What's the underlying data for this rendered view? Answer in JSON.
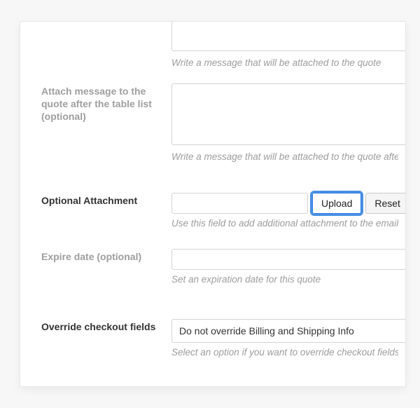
{
  "fields": {
    "msg_before": {
      "value": "",
      "helper": "Write a message that will be attached to the quote"
    },
    "msg_after": {
      "label": "Attach message to the quote after the table list (optional)",
      "value": "",
      "helper": "Write a message that will be attached to the quote after the table list"
    },
    "attachment": {
      "label": "Optional Attachment",
      "value": "",
      "upload_label": "Upload",
      "reset_label": "Reset",
      "helper": "Use this field to add additional attachment to the email"
    },
    "expire": {
      "label": "Expire date (optional)",
      "value": "",
      "helper": "Set an expiration date for this quote"
    },
    "override": {
      "label": "Override checkout fields",
      "selected": "Do not override Billing and Shipping Info",
      "helper": "Select an option if you want to override checkout fields."
    }
  }
}
